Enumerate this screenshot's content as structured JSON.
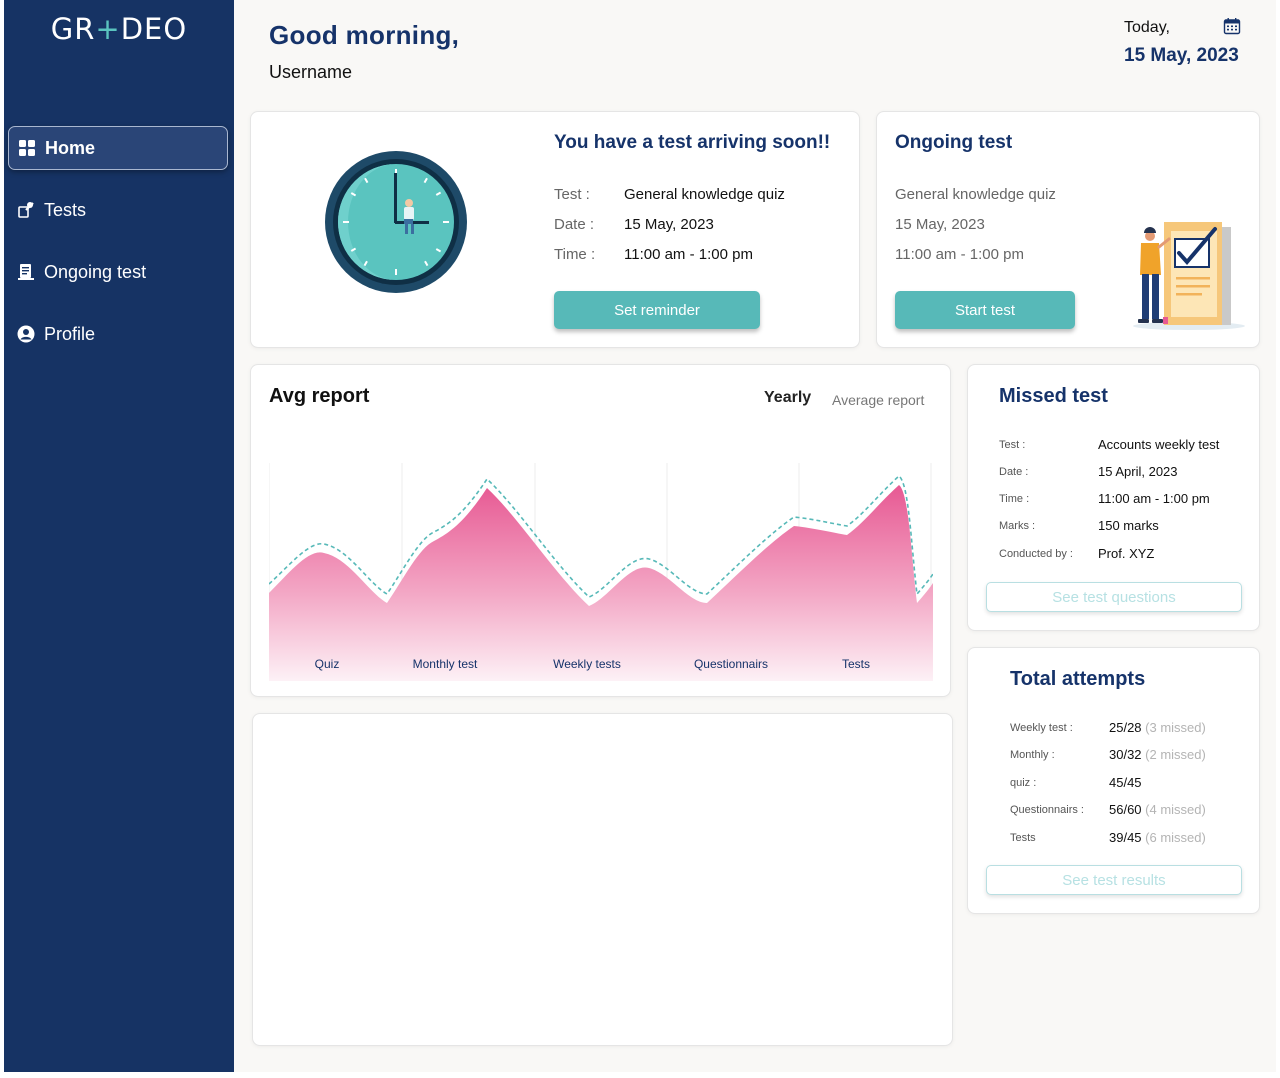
{
  "brand": {
    "logo_prefix": "GR",
    "logo_mark": "+",
    "logo_suffix": "DEO"
  },
  "sidebar": {
    "items": [
      {
        "label": "Home",
        "icon": "grid-icon",
        "active": true
      },
      {
        "label": "Tests",
        "icon": "test-icon",
        "active": false
      },
      {
        "label": "Ongoing test",
        "icon": "document-icon",
        "active": false
      },
      {
        "label": "Profile",
        "icon": "user-icon",
        "active": false
      }
    ]
  },
  "header": {
    "greeting": "Good morning,",
    "username": "Username",
    "today_label": "Today,",
    "today_date": "15 May, 2023"
  },
  "upcoming": {
    "title": "You have a test arriving soon!!",
    "rows": [
      {
        "label": "Test :",
        "value": "General knowledge quiz"
      },
      {
        "label": "Date :",
        "value": "15 May, 2023"
      },
      {
        "label": "Time :",
        "value": "11:00 am - 1:00 pm"
      }
    ],
    "button": "Set reminder"
  },
  "ongoing": {
    "title": "Ongoing test",
    "name": "General knowledge quiz",
    "date": "15 May, 2023",
    "time": "11:00 am - 1:00 pm",
    "button": "Start test"
  },
  "avg_report": {
    "title": "Avg report",
    "toggle_active": "Yearly",
    "toggle_other": "Average report"
  },
  "chart_data": {
    "type": "area",
    "categories": [
      "Quiz",
      "Monthly test",
      "Weekly tests",
      "Questionnairs",
      "Tests"
    ],
    "series": [
      {
        "fill_color": "#e75993",
        "outline_color": "#57b9b8"
      }
    ],
    "grid": false,
    "legend": "none",
    "title": "",
    "xlabel": "",
    "ylabel": ""
  },
  "missed_test": {
    "title": "Missed test",
    "rows": [
      {
        "label": "Test :",
        "value": "Accounts weekly test"
      },
      {
        "label": "Date :",
        "value": "15 April, 2023"
      },
      {
        "label": "Time :",
        "value": "11:00 am - 1:00 pm"
      },
      {
        "label": "Marks :",
        "value": "150 marks"
      },
      {
        "label": "Conducted by :",
        "value": "Prof. XYZ"
      }
    ],
    "button": "See test questions"
  },
  "total_attempts": {
    "title": "Total attempts",
    "rows": [
      {
        "label": "Weekly test :",
        "value": "25/28",
        "missed": "(3 missed)"
      },
      {
        "label": "Monthly :",
        "value": "30/32",
        "missed": "(2 missed)"
      },
      {
        "label": "quiz :",
        "value": "45/45",
        "missed": ""
      },
      {
        "label": "Questionnairs :",
        "value": "56/60",
        "missed": "(4 missed)"
      },
      {
        "label": "Tests",
        "value": "39/45",
        "missed": "(6 missed)"
      }
    ],
    "button": "See test results"
  },
  "colors": {
    "sidebar": "#163364",
    "title_navy": "#16336a",
    "teal": "#57b9b8",
    "pink": "#e75993",
    "background": "#f9f8f6"
  }
}
